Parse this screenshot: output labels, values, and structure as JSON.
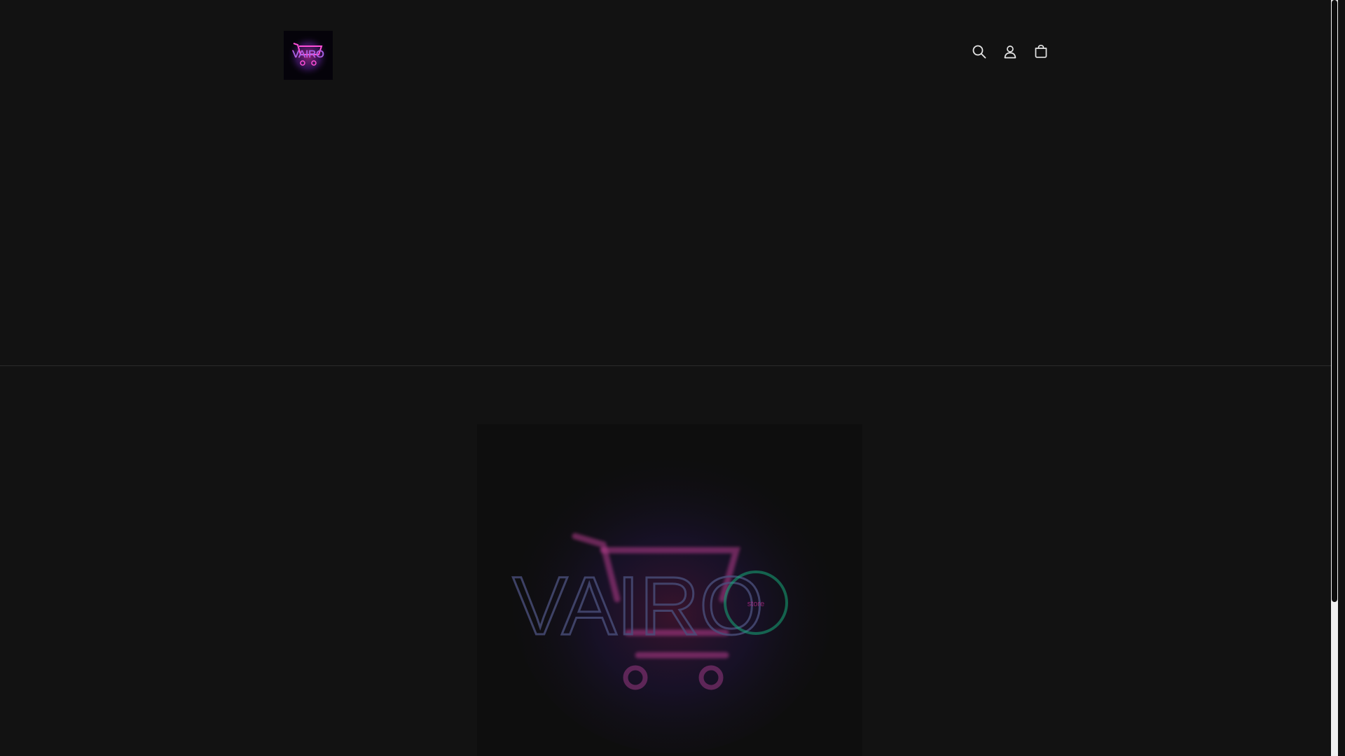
{
  "header": {
    "logo": {
      "alt": "VAIRO",
      "text": "VAIRO",
      "colors": {
        "pink": "#ff3fcf",
        "blue": "#3a7bff",
        "purple": "#a23cff"
      }
    },
    "icons": [
      {
        "name": "search-icon",
        "label": "Search"
      },
      {
        "name": "account-icon",
        "label": "Log in"
      },
      {
        "name": "cart-icon",
        "label": "Cart"
      }
    ]
  },
  "hero": {
    "image_alt": "VAIRO store logo",
    "logo_text": "VAIRO",
    "logo_subtext": "store",
    "colors": {
      "pink": "#ff2bb0",
      "blue": "#3a6bff",
      "green": "#19d49a",
      "purple": "#a23cff"
    }
  },
  "theme": {
    "background": "#121212",
    "icon_color": "#e6e6e6",
    "divider": "#2a2a2a"
  }
}
